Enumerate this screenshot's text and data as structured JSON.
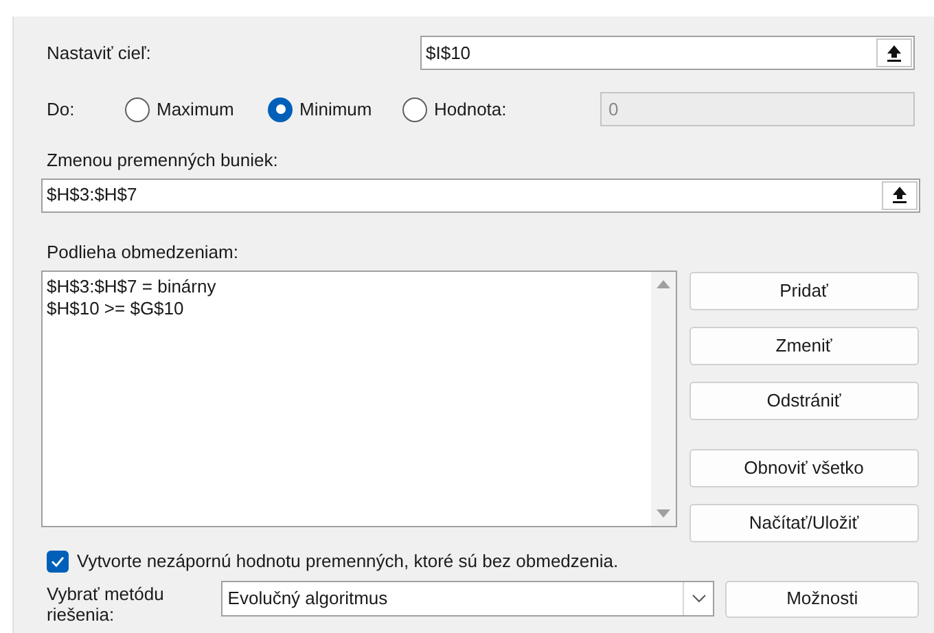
{
  "objective": {
    "label": "Nastaviť cieľ:",
    "value": "$I$10"
  },
  "to": {
    "label": "Do:",
    "options": [
      {
        "label": "Maximum",
        "selected": false
      },
      {
        "label": "Minimum",
        "selected": true
      },
      {
        "label": "Hodnota:",
        "selected": false
      }
    ],
    "value_field": {
      "value": "0",
      "disabled": true
    }
  },
  "variables": {
    "label": "Zmenou premenných buniek:",
    "value": "$H$3:$H$7"
  },
  "constraints": {
    "label": "Podlieha obmedzeniam:",
    "items": [
      "$H$3:$H$7 = binárny",
      "$H$10 >= $G$10"
    ]
  },
  "buttons": [
    "Pridať",
    "Zmeniť",
    "Odstrániť",
    "Obnoviť všetko",
    "Načítať/Uložiť"
  ],
  "nonnegative": {
    "label": "Vytvorte nezápornú hodnotu premenných, ktoré sú bez obmedzenia.",
    "checked": true
  },
  "method": {
    "label": "Vybrať metódu riešenia:",
    "value": "Evolučný algoritmus"
  },
  "options_button": "Možnosti"
}
